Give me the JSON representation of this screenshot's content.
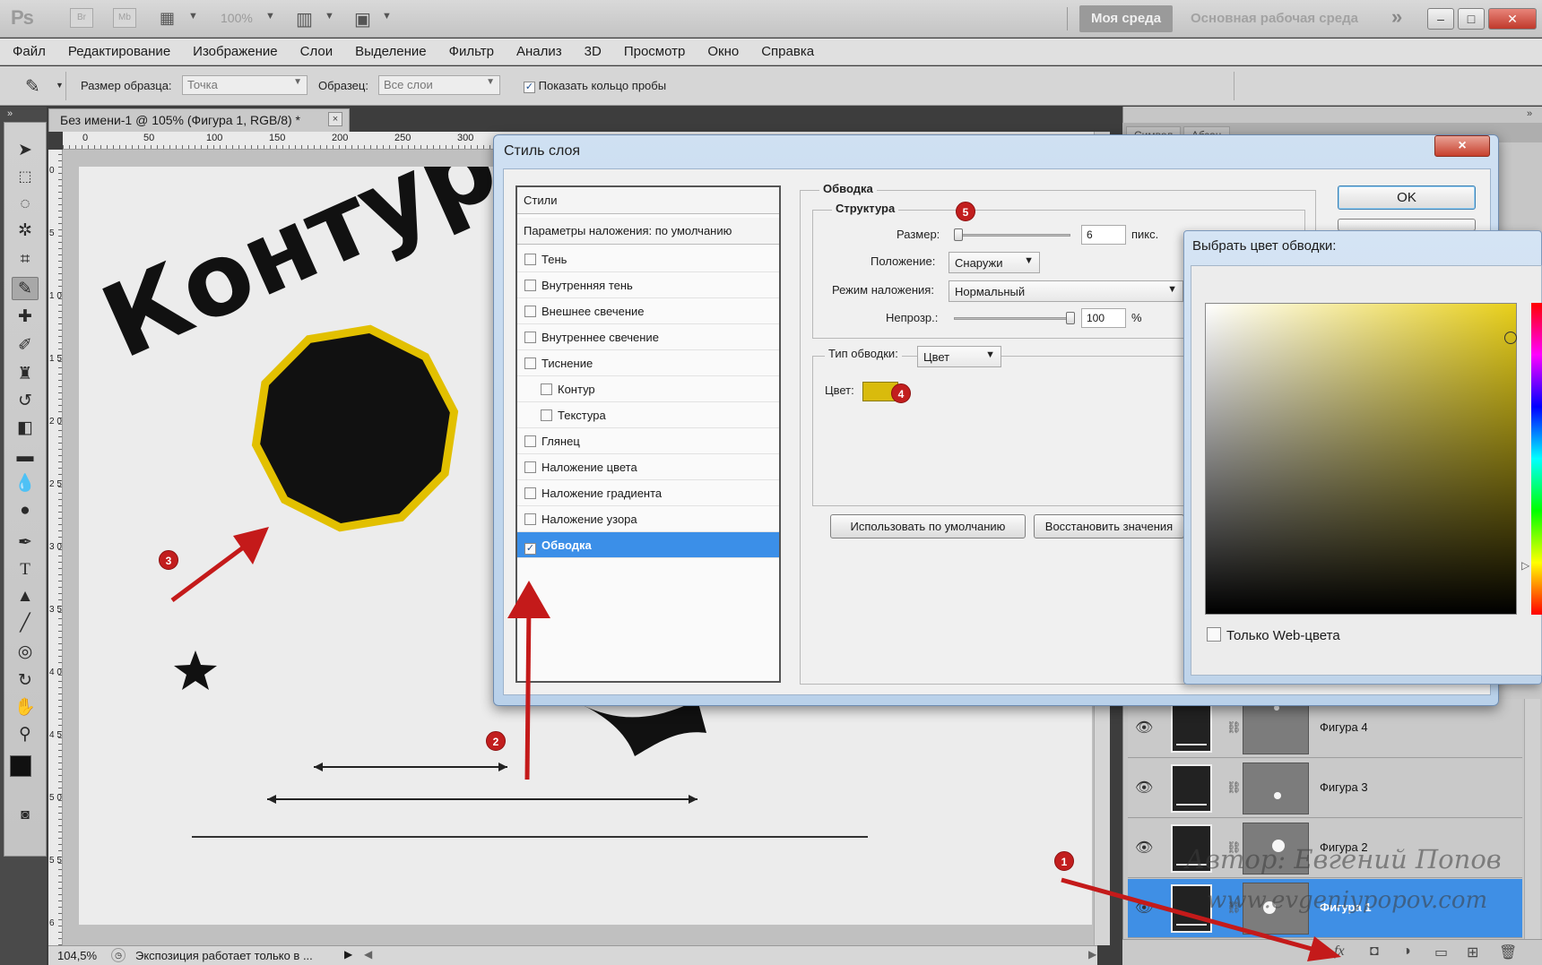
{
  "app": {
    "logo": "Ps",
    "bridge_btn": "Br",
    "minibridge_btn": "Mb",
    "zoom": "100%",
    "workspace_active": "Моя среда",
    "workspace_main": "Основная рабочая среда",
    "more_icon": "»"
  },
  "menu": [
    "Файл",
    "Редактирование",
    "Изображение",
    "Слои",
    "Выделение",
    "Фильтр",
    "Анализ",
    "3D",
    "Просмотр",
    "Окно",
    "Справка"
  ],
  "options": {
    "sample_size_label": "Размер образца:",
    "sample_size_value": "Точка",
    "sample_label": "Образец:",
    "sample_value": "Все слои",
    "show_ring_label": "Показать кольцо пробы",
    "show_ring_checked": "✓"
  },
  "document": {
    "tab_title": "Без имени-1 @ 105% (Фигура 1, RGB/8) *",
    "close": "×",
    "ruler_top": [
      "0",
      "50",
      "100",
      "150",
      "200",
      "250",
      "300"
    ],
    "ruler_left": [
      "0",
      "5",
      "1 0",
      "1 5",
      "2 0",
      "2 5",
      "3 0",
      "3 5",
      "4 0",
      "4 5",
      "5 0",
      "5 5",
      "6"
    ],
    "canvas_text": "Контур",
    "zoom_status": "104,5%",
    "status_text": "Экспозиция работает только в ...",
    "stroke_color": "#e2c000"
  },
  "dialog": {
    "title": "Стиль слоя",
    "close": "×",
    "styles_header": "Стили",
    "blending_default": "Параметры наложения: по умолчанию",
    "styles": [
      {
        "label": "Тень",
        "checked": ""
      },
      {
        "label": "Внутренняя тень",
        "checked": ""
      },
      {
        "label": "Внешнее свечение",
        "checked": ""
      },
      {
        "label": "Внутреннее свечение",
        "checked": ""
      },
      {
        "label": "Тиснение",
        "checked": ""
      },
      {
        "label": "Контур",
        "checked": ""
      },
      {
        "label": "Текстура",
        "checked": ""
      },
      {
        "label": "Глянец",
        "checked": ""
      },
      {
        "label": "Наложение цвета",
        "checked": ""
      },
      {
        "label": "Наложение градиента",
        "checked": ""
      },
      {
        "label": "Наложение узора",
        "checked": ""
      },
      {
        "label": "Обводка",
        "checked": "✓"
      }
    ],
    "stroke_group": "Обводка",
    "structure_group": "Структура",
    "size_label": "Размер:",
    "size_value": "6",
    "size_unit": "пикс.",
    "position_label": "Положение:",
    "position_value": "Снаружи",
    "blend_mode_label": "Режим наложения:",
    "blend_mode_value": "Нормальный",
    "opacity_label": "Непрозр.:",
    "opacity_value": "100",
    "opacity_unit": "%",
    "fill_type_label": "Тип обводки:",
    "fill_type_value": "Цвет",
    "color_label": "Цвет:",
    "color_swatch": "#d9bb0c",
    "make_default_btn": "Использовать по умолчанию",
    "reset_default_btn": "Восстановить значения",
    "ok_btn": "OK"
  },
  "color_picker": {
    "title": "Выбрать цвет обводки:",
    "web_only_label": "Только Web-цвета",
    "hue_color": "#e8cf1a"
  },
  "layers": [
    {
      "name": "Фигура 4",
      "selected": false
    },
    {
      "name": "Фигура 3",
      "selected": false
    },
    {
      "name": "Фигура 2",
      "selected": false
    },
    {
      "name": "Фигура 1",
      "selected": true
    }
  ],
  "panel_tabs": [
    "Символ",
    "Абзац"
  ],
  "watermark": {
    "line1": "Автор: Евгений Попов",
    "line2": "www.evgeniypopov.com"
  },
  "annotations": [
    "1",
    "2",
    "3",
    "4",
    "5"
  ],
  "accent_arrow_color": "#c41a1a"
}
